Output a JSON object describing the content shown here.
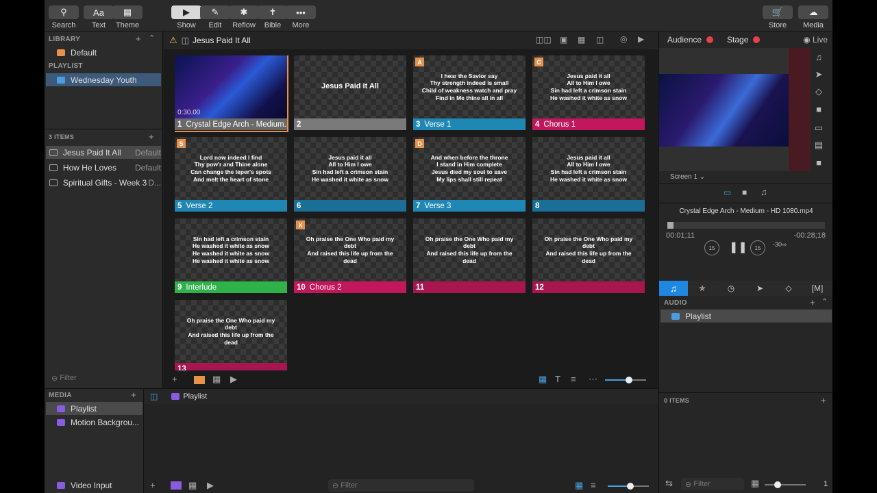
{
  "toolbar": {
    "search": "Search",
    "text": "Text",
    "theme": "Theme",
    "show": "Show",
    "edit": "Edit",
    "reflow": "Reflow",
    "bible": "Bible",
    "more": "More",
    "store": "Store",
    "media": "Media"
  },
  "library": {
    "header": "LIBRARY",
    "default": "Default",
    "playlist_header": "PLAYLIST",
    "playlist_item": "Wednesday Youth",
    "items_header": "3 ITEMS",
    "items": [
      {
        "name": "Jesus Paid It All",
        "tag": "Default"
      },
      {
        "name": "How He Loves",
        "tag": "Default"
      },
      {
        "name": "Spiritual Gifts - Week 3",
        "tag": "D..."
      }
    ],
    "filter_placeholder": "Filter"
  },
  "presentation": {
    "title": "Jesus Paid It All",
    "slides": [
      {
        "num": "1",
        "label": "Crystal Edge Arch - Medium...",
        "time": "0:30.00",
        "badge": "",
        "text": "",
        "color": "#6a6a6a"
      },
      {
        "num": "2",
        "label": "",
        "badge": "",
        "text": "Jesus Paid it All",
        "color": "#7a7a7a"
      },
      {
        "num": "3",
        "label": "Verse 1",
        "badge": "A",
        "text": "I hear the Savior say\nThy strength indeed is small\nChild of weakness watch and pray\nFind in Me thine all in all",
        "color": "#1e87b4"
      },
      {
        "num": "4",
        "label": "Chorus 1",
        "badge": "C",
        "text": "Jesus paid it all\nAll to Him I owe\nSin had left a crimson stain\nHe washed it white as snow",
        "color": "#c2185b"
      },
      {
        "num": "5",
        "label": "Verse 2",
        "badge": "S",
        "text": "Lord now indeed I find\nThy pow'r and Thine alone\nCan change the leper's spots\nAnd melt the heart of stone",
        "color": "#1e87b4"
      },
      {
        "num": "6",
        "label": "",
        "badge": "",
        "text": "Jesus paid it all\nAll to Him I owe\nSin had left a crimson stain\nHe washed it white as snow",
        "color": "#1a6f96"
      },
      {
        "num": "7",
        "label": "Verse 3",
        "badge": "D",
        "text": "And when before the throne\nI stand in Him complete\nJesus died my soul to save\nMy lips shall still repeat",
        "color": "#1e87b4"
      },
      {
        "num": "8",
        "label": "",
        "badge": "",
        "text": "Jesus paid it all\nAll to Him I owe\nSin had left a crimson stain\nHe washed it white as snow",
        "color": "#1a6f96"
      },
      {
        "num": "9",
        "label": "Interlude",
        "badge": "",
        "text": "Sin had left a crimson stain\nHe washed it white as snow\nHe washed it white as snow\nHe washed it white as snow",
        "color": "#2fb24a"
      },
      {
        "num": "10",
        "label": "Chorus 2",
        "badge": "X",
        "text": "Oh praise the One Who paid my debt\nAnd raised this life up from the dead",
        "color": "#c2185b"
      },
      {
        "num": "11",
        "label": "",
        "badge": "",
        "text": "Oh praise the One Who paid my debt\nAnd raised this life up from the dead",
        "color": "#a8164f"
      },
      {
        "num": "12",
        "label": "",
        "badge": "",
        "text": "Oh praise the One Who paid my debt\nAnd raised this life up from the dead",
        "color": "#a8164f"
      },
      {
        "num": "13",
        "label": "",
        "badge": "",
        "text": "Oh praise the One Who paid my debt\nAnd raised this life up from the dead",
        "color": "#a8164f"
      }
    ]
  },
  "media_bin": {
    "header": "MEDIA",
    "playlist": "Playlist",
    "motion": "Motion Backgrou...",
    "video_input": "Video Input",
    "center_playlist": "Playlist",
    "filter_placeholder": "Filter"
  },
  "right": {
    "audience": "Audience",
    "stage": "Stage",
    "live": "Live",
    "screen": "Screen 1",
    "media_name": "Crystal Edge Arch - Medium - HD 1080.mp4",
    "elapsed": "00:01;11",
    "remaining": "-00:28;18",
    "skip_back": "15",
    "skip_fwd": "15",
    "skip_end": "-30",
    "audio_header": "AUDIO",
    "audio_playlist": "Playlist",
    "items_count": "0 ITEMS",
    "filter_placeholder": "Filter",
    "page_num": "1",
    "progress": 0.04
  },
  "icons": {
    "warning": "warning-icon",
    "live_dot": "#e8404a"
  }
}
